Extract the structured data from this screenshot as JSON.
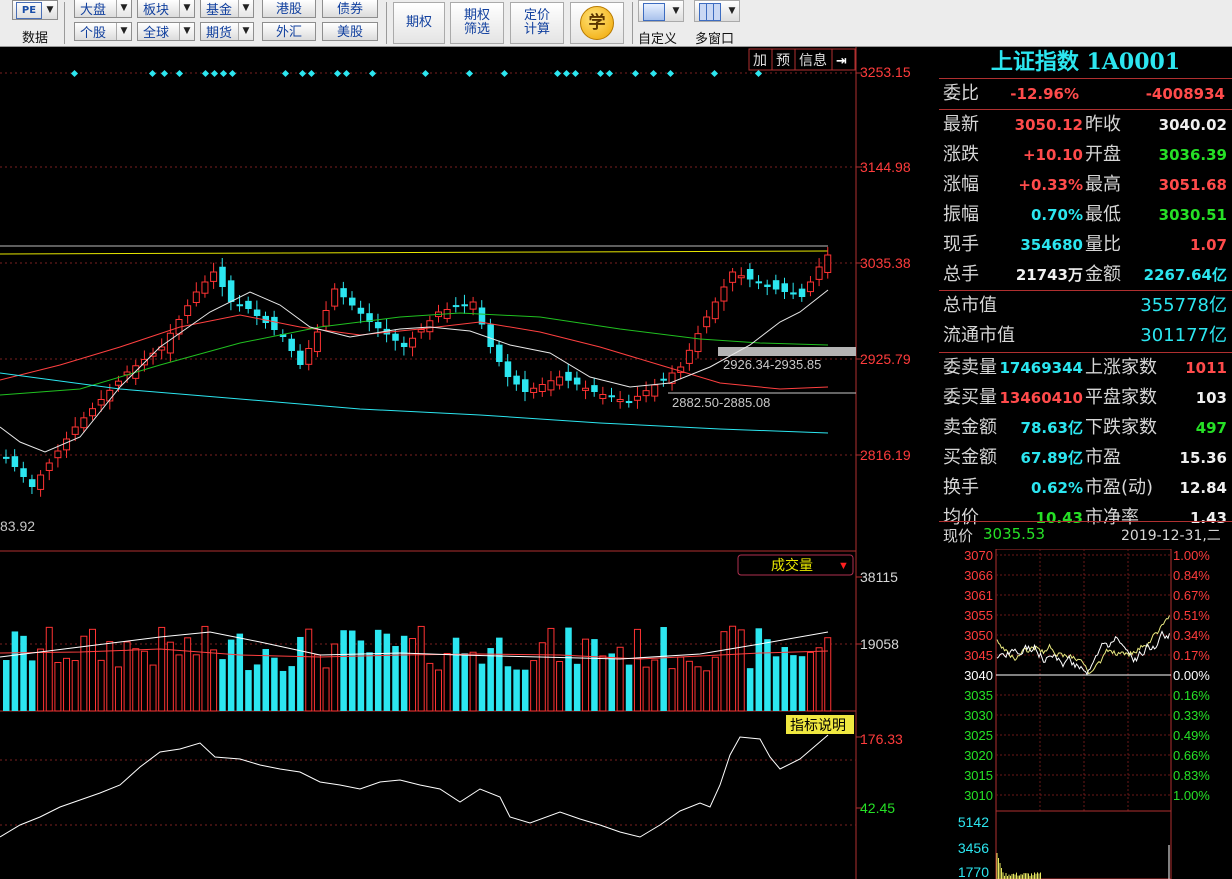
{
  "toolbar": {
    "pe_label": "PE",
    "data_label": "数据",
    "row1": [
      "大盘",
      "板块",
      "基金",
      "港股",
      "债券"
    ],
    "row2": [
      "个股",
      "全球",
      "期货",
      "外汇",
      "美股"
    ],
    "options": "期权",
    "options_filter": [
      "期权",
      "筛选"
    ],
    "pricing_calc": [
      "定价",
      "计算"
    ],
    "learn": "学",
    "custom": "自定义",
    "multi_window": "多窗口"
  },
  "kline": {
    "tabs": [
      "加",
      "预",
      "信息"
    ],
    "price_axis": [
      "3253.15",
      "3144.98",
      "3035.38",
      "2925.79",
      "2816.19"
    ],
    "low_label": "83.92",
    "gap_upper": "2926.34-2935.85",
    "gap_lower": "2882.50-2885.08",
    "volume_title": "成交量",
    "volume_axis": [
      "38115",
      "19058"
    ],
    "indicator_title": "指标说明",
    "indicator_axis": [
      "176.33",
      "42.45"
    ]
  },
  "quote": {
    "title": "上证指数 1A0001",
    "weibi": {
      "label": "委比",
      "pct": "-12.96%",
      "diff": "-4008934"
    },
    "rows": [
      {
        "l1": "最新",
        "v1": "3050.12",
        "c1": "red",
        "l2": "昨收",
        "v2": "3040.02",
        "c2": "wht"
      },
      {
        "l1": "涨跌",
        "v1": "+10.10",
        "c1": "red",
        "l2": "开盘",
        "v2": "3036.39",
        "c2": "grn"
      },
      {
        "l1": "涨幅",
        "v1": "+0.33%",
        "c1": "red",
        "l2": "最高",
        "v2": "3051.68",
        "c2": "red"
      },
      {
        "l1": "振幅",
        "v1": "0.70%",
        "c1": "cyan",
        "l2": "最低",
        "v2": "3030.51",
        "c2": "grn"
      },
      {
        "l1": "现手",
        "v1": "354680",
        "c1": "cyan",
        "l2": "量比",
        "v2": "1.07",
        "c2": "red"
      },
      {
        "l1": "总手",
        "v1": "21743万",
        "c1": "wht",
        "l2": "金额",
        "v2": "2267.64亿",
        "c2": "cyan"
      }
    ],
    "mcap": [
      {
        "label": "总市值",
        "value": "355778亿"
      },
      {
        "label": "流通市值",
        "value": "301177亿"
      }
    ],
    "rows2": [
      {
        "l1": "委卖量",
        "v1": "17469344",
        "c1": "cyan",
        "l2": "上涨家数",
        "v2": "1011",
        "c2": "red"
      },
      {
        "l1": "委买量",
        "v1": "13460410",
        "c1": "red",
        "l2": "平盘家数",
        "v2": "103",
        "c2": "wht"
      },
      {
        "l1": "卖金额",
        "v1": "78.63亿",
        "c1": "cyan",
        "l2": "下跌家数",
        "v2": "497",
        "c2": "grn"
      },
      {
        "l1": "买金额",
        "v1": "67.89亿",
        "c1": "cyan",
        "l2": "市盈",
        "v2": "15.36",
        "c2": "wht"
      },
      {
        "l1": "换手",
        "v1": "0.62%",
        "c1": "cyan",
        "l2": "市盈(动)",
        "v2": "12.84",
        "c2": "wht"
      },
      {
        "l1": "均价",
        "v1": "10.43",
        "c1": "grn",
        "l2": "市净率",
        "v2": "1.43",
        "c2": "wht"
      }
    ],
    "mini": {
      "price_label": "现价",
      "price": "3035.53",
      "date": "2019-12-31,二",
      "left_axis": [
        "3070",
        "3066",
        "3061",
        "3055",
        "3050",
        "3045",
        "3040",
        "3035",
        "3030",
        "3025",
        "3020",
        "3015",
        "3010"
      ],
      "right_axis": [
        "1.00%",
        "0.84%",
        "0.67%",
        "0.51%",
        "0.34%",
        "0.17%",
        "0.00%",
        "0.16%",
        "0.33%",
        "0.49%",
        "0.66%",
        "0.83%",
        "1.00%"
      ],
      "vol_axis": [
        "5142",
        "3456",
        "1770"
      ]
    }
  }
}
